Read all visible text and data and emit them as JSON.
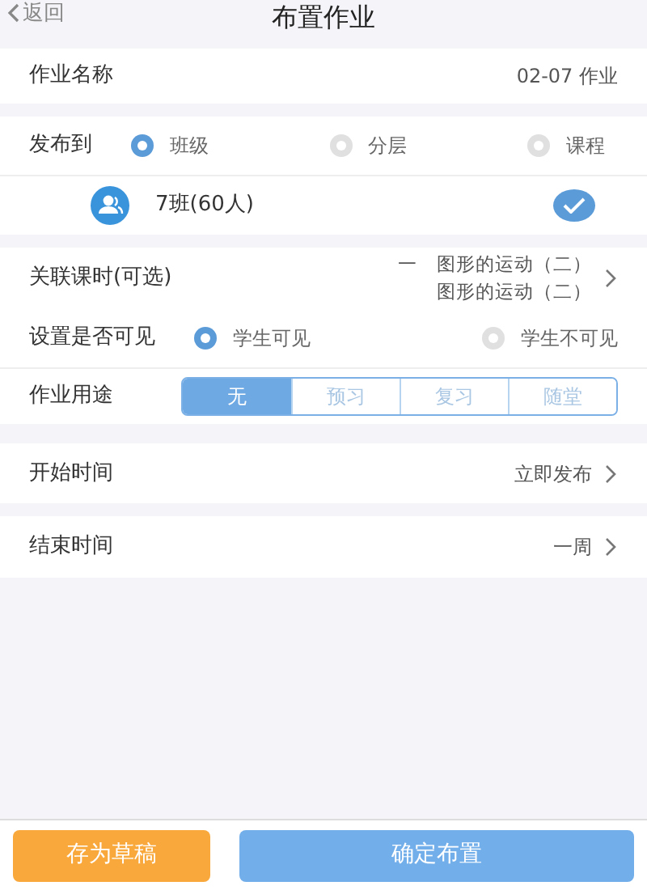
{
  "header": {
    "back": "返回",
    "title": "布置作业"
  },
  "name_row": {
    "label": "作业名称",
    "value": "02-07 作业"
  },
  "publish": {
    "label": "发布到",
    "options": [
      {
        "label": "班级",
        "selected": true
      },
      {
        "label": "分层",
        "selected": false
      },
      {
        "label": "课程",
        "selected": false
      }
    ]
  },
  "classes": [
    {
      "name": "7班(60人)",
      "checked": true
    }
  ],
  "lesson": {
    "label": "关联课时(可选)",
    "lines": [
      "一　图形的运动（二）",
      "图形的运动（二）"
    ]
  },
  "visibility": {
    "label": "设置是否可见",
    "options": [
      {
        "label": "学生可见",
        "selected": true
      },
      {
        "label": "学生不可见",
        "selected": false
      }
    ]
  },
  "purpose": {
    "label": "作业用途",
    "segments": [
      {
        "label": "无",
        "selected": true
      },
      {
        "label": "预习",
        "selected": false
      },
      {
        "label": "复习",
        "selected": false
      },
      {
        "label": "随堂",
        "selected": false
      }
    ]
  },
  "start": {
    "label": "开始时间",
    "value": "立即发布"
  },
  "end": {
    "label": "结束时间",
    "value": "一周"
  },
  "buttons": [
    {
      "label": "存为草稿",
      "kind": "draft"
    },
    {
      "label": "确定布置",
      "kind": "confirm"
    }
  ]
}
